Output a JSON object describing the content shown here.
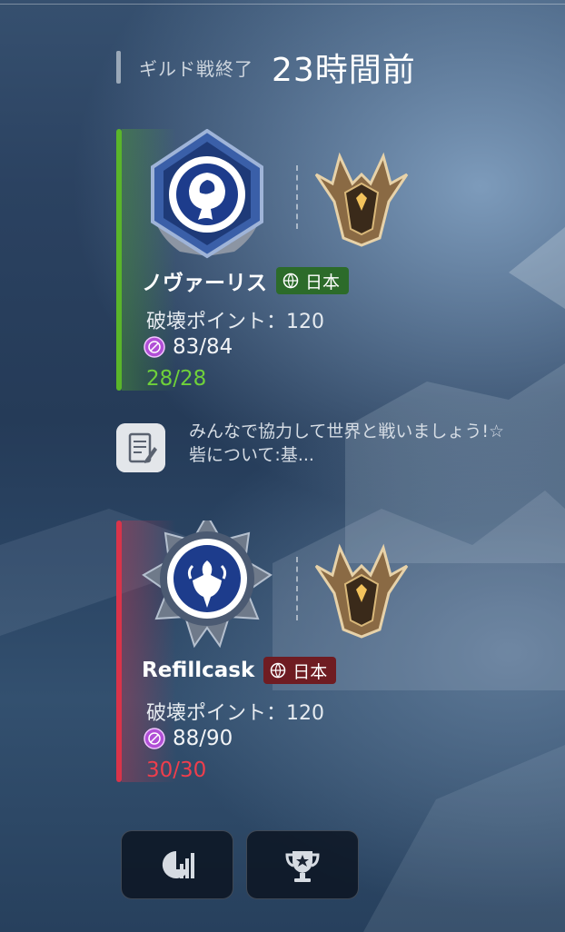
{
  "header": {
    "label": "ギルド戦終了",
    "time": "23時間前"
  },
  "guilds": [
    {
      "name": "ノヴァーリス",
      "region": "日本",
      "points": "破壊ポイント：120",
      "members": "83/84",
      "attacks": "28/28",
      "result": "win"
    },
    {
      "name": "Refillcask",
      "region": "日本",
      "points": "破壊ポイント：120",
      "members": "88/90",
      "attacks": "30/30",
      "result": "lose"
    }
  ],
  "message": {
    "text": "みんなで協力して世界と戦いましょう!☆砦について:基..."
  },
  "buttons": {
    "stats_icon": "stats-icon",
    "trophy_icon": "trophy-icon"
  },
  "colors": {
    "win": "#5ab52a",
    "lose": "#d9344a"
  }
}
